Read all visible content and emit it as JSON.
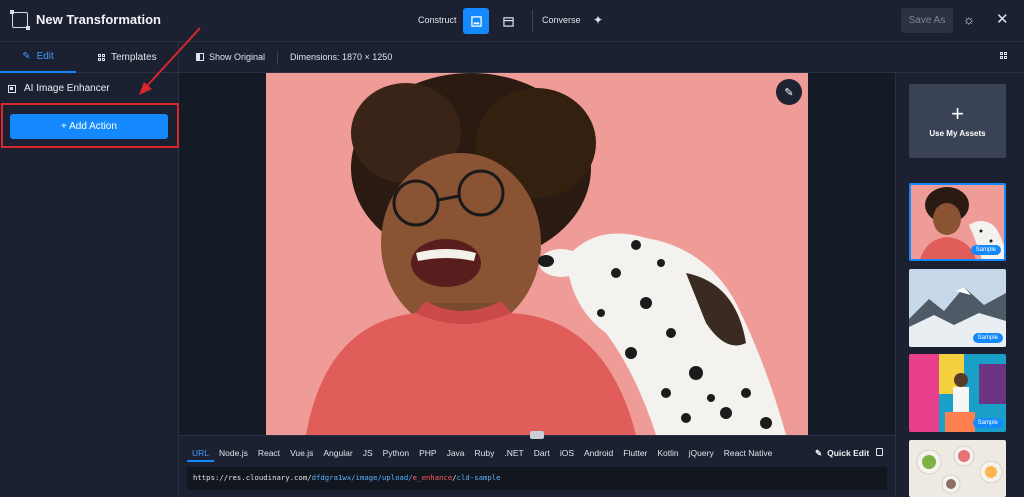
{
  "header": {
    "title": "New Transformation",
    "construct_label": "Construct",
    "converse_label": "Converse",
    "save_as_label": "Save As"
  },
  "toolbar": {
    "tabs": [
      {
        "label": "Edit",
        "active": true
      },
      {
        "label": "Templates",
        "active": false
      }
    ],
    "show_original_label": "Show Original",
    "dimensions_label": "Dimensions: 1870 × 1250"
  },
  "sidebar": {
    "action_item_label": "AI Image Enhancer",
    "add_action_label": "+ Add Action"
  },
  "right_panel": {
    "use_assets_label": "Use My Assets",
    "samples": [
      {
        "badge": "Sample"
      },
      {
        "badge": "Sample"
      },
      {
        "badge": "Sample"
      }
    ]
  },
  "code_panel": {
    "languages": [
      "URL",
      "Node.js",
      "React",
      "Vue.js",
      "Angular",
      "JS",
      "Python",
      "PHP",
      "Java",
      "Ruby",
      ".NET",
      "Dart",
      "iOS",
      "Android",
      "Flutter",
      "Kotlin",
      "jQuery",
      "React Native"
    ],
    "active_language": "URL",
    "quick_edit_label": "Quick Edit",
    "url": {
      "base": "https://res.cloudinary.com/",
      "path": "dfdgra1wx/image/upload/",
      "transform": "e_enhance",
      "slash": "/",
      "public_id": "cld-sample"
    }
  },
  "colors": {
    "accent": "#1389fd",
    "background": "#141a26",
    "panel": "#1b2130",
    "highlight": "#d9262c",
    "photo_bg": "#ef9c98"
  },
  "icons": [
    "transform-icon",
    "image-mode-icon",
    "calendar-mode-icon",
    "sparkle-icon",
    "sun-icon",
    "close-icon",
    "pencil-icon",
    "templates-grid-icon",
    "compare-icon",
    "layout-grid-icon",
    "enhancer-icon",
    "plus-icon",
    "copy-icon"
  ]
}
